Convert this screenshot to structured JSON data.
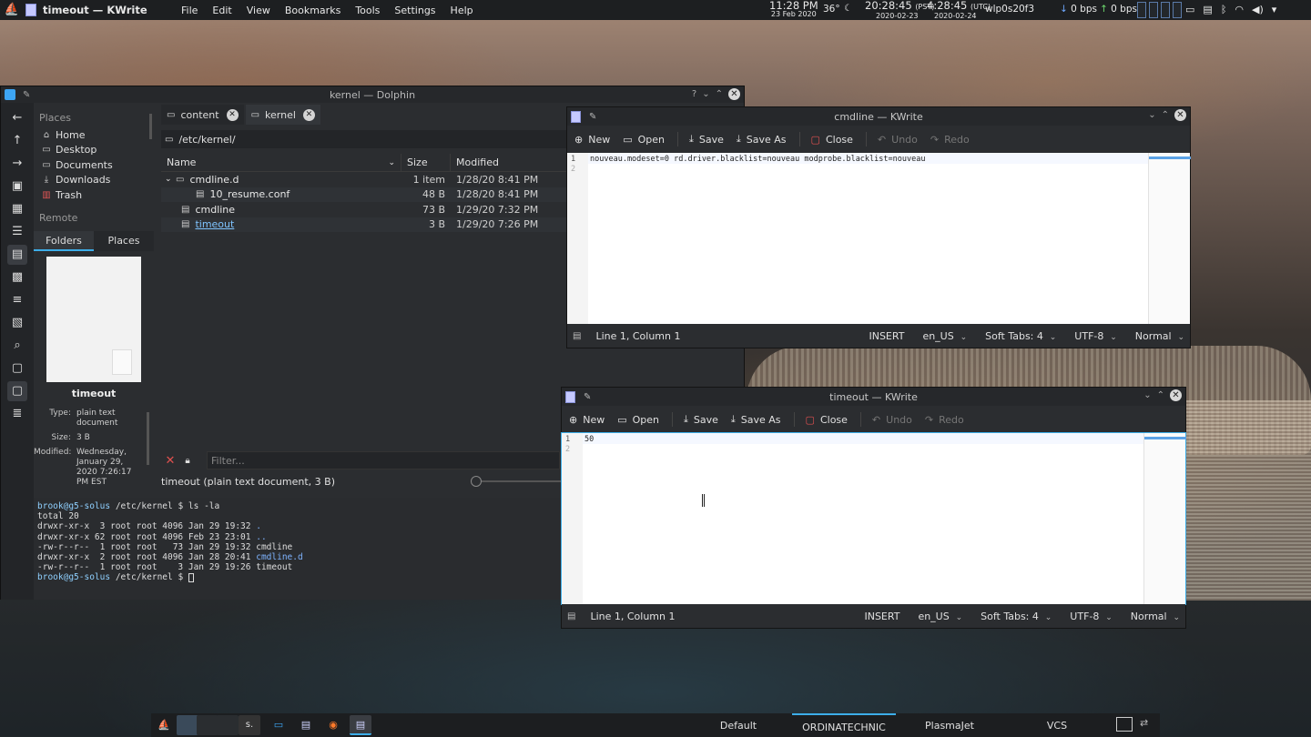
{
  "top_panel": {
    "window_title": "timeout — KWrite",
    "menus": [
      "File",
      "Edit",
      "View",
      "Bookmarks",
      "Tools",
      "Settings",
      "Help"
    ],
    "local_time": "11:28 PM",
    "local_date": "23 Feb 2020",
    "temperature": "36°",
    "pst_time": "20:28:45",
    "pst_label": "(PST)",
    "pst_date": "2020-02-23",
    "utc_time": "4:28:45",
    "utc_label": "(UTC)",
    "utc_date": "2020-02-24",
    "network_iface": "wlp0s20f3",
    "down_speed": "0 bps",
    "up_speed": "0 bps"
  },
  "dolphin": {
    "title": "kernel — Dolphin",
    "places_header": "Places",
    "places": [
      {
        "label": "Home",
        "icon": "home-icon"
      },
      {
        "label": "Desktop",
        "icon": "desktop-icon"
      },
      {
        "label": "Documents",
        "icon": "documents-icon"
      },
      {
        "label": "Downloads",
        "icon": "downloads-icon"
      },
      {
        "label": "Trash",
        "icon": "trash-icon"
      }
    ],
    "remote_header": "Remote",
    "panel_tabs": [
      "Folders",
      "Places"
    ],
    "preview_name": "timeout",
    "meta": {
      "type_label": "Type:",
      "type_value": "plain text document",
      "size_label": "Size:",
      "size_value": "3 B",
      "modified_label": "Modified:",
      "modified_value": "Wednesday, January 29, 2020 7:26:17 PM EST"
    },
    "tabs": [
      {
        "label": "content"
      },
      {
        "label": "kernel"
      }
    ],
    "path": "/etc/kernel/",
    "columns": {
      "name": "Name",
      "size": "Size",
      "modified": "Modified"
    },
    "files": [
      {
        "name": "cmdline.d",
        "size": "1 item",
        "modified": "1/28/20 8:41 PM"
      },
      {
        "name": "10_resume.conf",
        "size": "48 B",
        "modified": "1/28/20 8:41 PM"
      },
      {
        "name": "cmdline",
        "size": "73 B",
        "modified": "1/29/20 7:32 PM"
      },
      {
        "name": "timeout",
        "size": "3 B",
        "modified": "1/29/20 7:26 PM"
      }
    ],
    "filter_placeholder": "Filter...",
    "status": "timeout (plain text document, 3 B)"
  },
  "terminal": {
    "prompt": "brook@g5-solus",
    "cwd": "/etc/kernel",
    "command": "ls -la",
    "lines": [
      "total 20",
      "drwxr-xr-x  3 root root 4096 Jan 29 19:32 ",
      "drwxr-xr-x 62 root root 4096 Feb 23 23:01 ",
      "-rw-r--r--  1 root root   73 Jan 29 19:32 cmdline",
      "drwxr-xr-x  2 root root 4096 Jan 28 20:41 ",
      "-rw-r--r--  1 root root    3 Jan 29 19:26 timeout"
    ],
    "dir_names": [
      ".",
      "..",
      "cmdline.d"
    ]
  },
  "kwrite_cmdline": {
    "title": "cmdline — KWrite",
    "toolbar": {
      "new": "New",
      "open": "Open",
      "save": "Save",
      "save_as": "Save As",
      "close": "Close",
      "undo": "Undo",
      "redo": "Redo"
    },
    "lines": [
      "1",
      "2"
    ],
    "content": "nouveau.modeset=0 rd.driver.blacklist=nouveau modprobe.blacklist=nouveau",
    "status": {
      "position": "Line 1, Column 1",
      "mode": "INSERT",
      "lang": "en_US",
      "tabs": "Soft Tabs: 4",
      "encoding": "UTF-8",
      "view": "Normal"
    }
  },
  "kwrite_timeout": {
    "title": "timeout — KWrite",
    "toolbar": {
      "new": "New",
      "open": "Open",
      "save": "Save",
      "save_as": "Save As",
      "close": "Close",
      "undo": "Undo",
      "redo": "Redo"
    },
    "lines": [
      "1",
      "2"
    ],
    "content": "50",
    "status": {
      "position": "Line 1, Column 1",
      "mode": "INSERT",
      "lang": "en_US",
      "tabs": "Soft Tabs: 4",
      "encoding": "UTF-8",
      "view": "Normal"
    }
  },
  "taskbar": {
    "activities": [
      "Default",
      "ORDINATECHNIC",
      "PlasmaJet",
      "VCS"
    ],
    "active_activity": "ORDINATECHNIC",
    "konsole_label": "s."
  },
  "colors": {
    "accent": "#3daee9",
    "close_red": "#e05050"
  }
}
